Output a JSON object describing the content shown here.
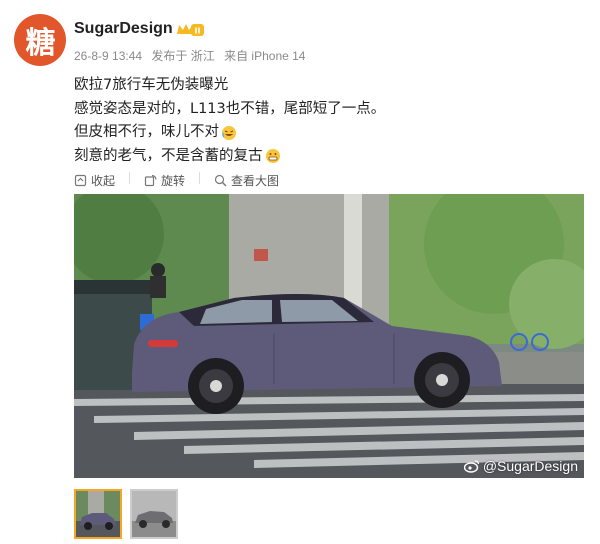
{
  "author": {
    "name": "SugarDesign",
    "avatar_glyph": "糖",
    "badge_text": "II",
    "badge_color": "#f5b921"
  },
  "meta": {
    "date": "26-8-9 13:44",
    "location": "发布于 浙江",
    "device": "来自 iPhone 14"
  },
  "post": {
    "lines": [
      "欧拉7旅行车无伪装曝光",
      "感觉姿态是对的，L113也不错，尾部短了一点。",
      "但皮相不行，味儿不对",
      "刻意的老气，不是含蓄的复古"
    ],
    "emoji": [
      "laugh-cry-emoji",
      "grimace-emoji"
    ]
  },
  "actions": {
    "collapse": "收起",
    "rotate": "旋转",
    "view_large": "查看大图"
  },
  "photo": {
    "watermark": "@SugarDesign",
    "description_icon": "weibo-icon"
  },
  "thumbnails": [
    {
      "name": "thumbnail-1",
      "active": true
    },
    {
      "name": "thumbnail-2",
      "active": false
    }
  ],
  "colors": {
    "accent": "#f7a623",
    "meta_text": "#8a8a8a",
    "avatar_bg": "#e2562b"
  }
}
